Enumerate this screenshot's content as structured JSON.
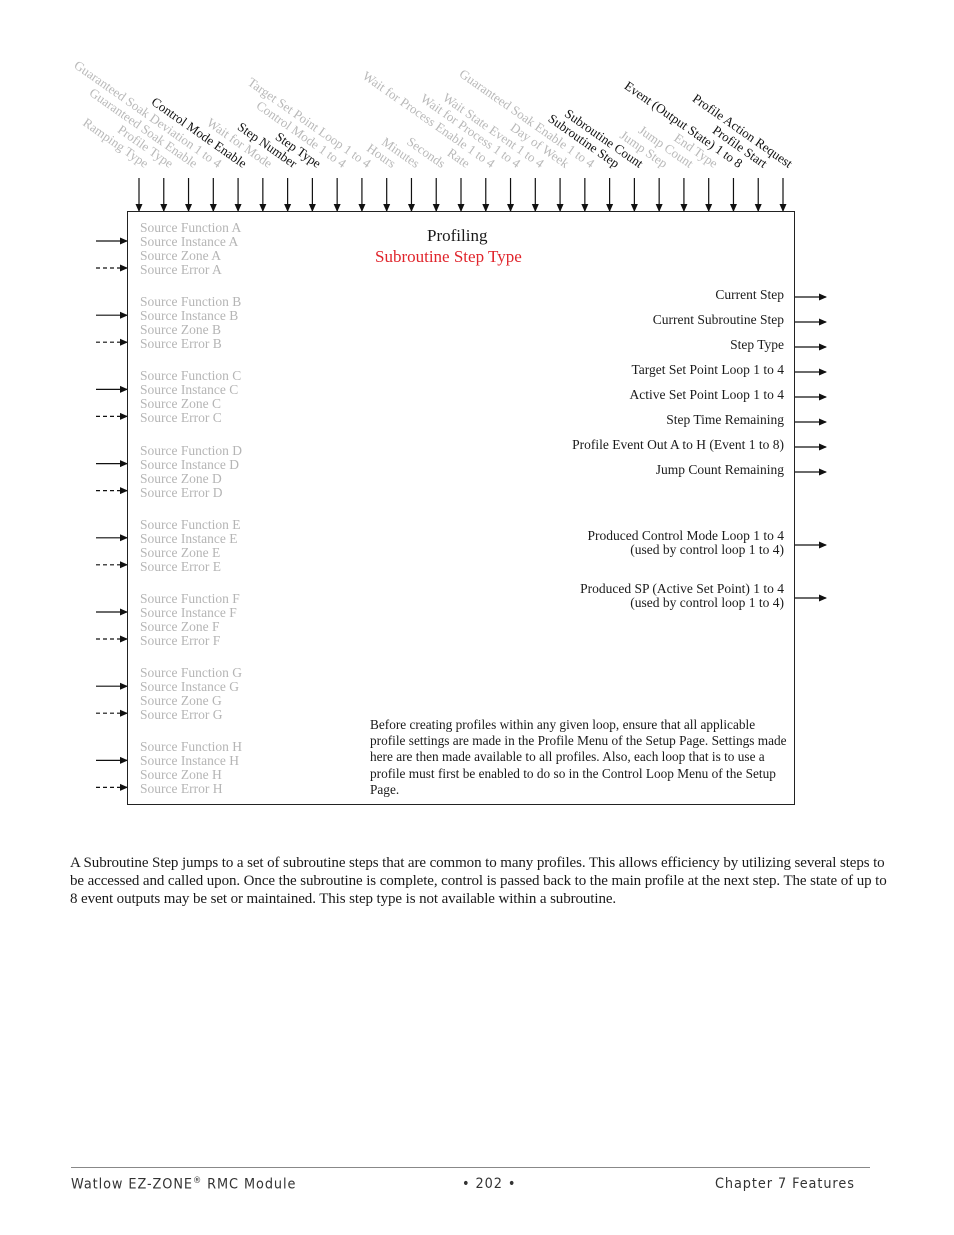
{
  "diagram": {
    "title": "Profiling",
    "subtitle": "Subroutine Step Type",
    "subtitle_color": "#e0242b",
    "top_inputs": [
      {
        "label": "Ramping Type",
        "active": false
      },
      {
        "label": "Profile Type",
        "active": false
      },
      {
        "label": "Guaranteed Soak Enable",
        "active": false
      },
      {
        "label": "Guaranteed Soak Deviation 1 to 4",
        "active": false
      },
      {
        "label": "Control Mode Enable",
        "active": true
      },
      {
        "label": "Wait for Mode",
        "active": false
      },
      {
        "label": "Step Number",
        "active": true
      },
      {
        "label": "Step Type",
        "active": true
      },
      {
        "label": "Control Mode 1 to 4",
        "active": false
      },
      {
        "label": "Target Set Point Loop 1 to 4",
        "active": false
      },
      {
        "label": "Hours",
        "active": false
      },
      {
        "label": "Minutes",
        "active": false
      },
      {
        "label": "Seconds",
        "active": false
      },
      {
        "label": "Rate",
        "active": false
      },
      {
        "label": "Wait for Process Enable 1 to 4",
        "active": false
      },
      {
        "label": "Wait for Process 1 to 4",
        "active": false
      },
      {
        "label": "Wait State Event 1 to 4",
        "active": false
      },
      {
        "label": "Day of Week",
        "active": false
      },
      {
        "label": "Guaranteed Soak Enable 1 to 4",
        "active": false
      },
      {
        "label": "Subroutine Step",
        "active": true
      },
      {
        "label": "Subroutine Count",
        "active": true
      },
      {
        "label": "Jump Step",
        "active": false
      },
      {
        "label": "Jump Count",
        "active": false
      },
      {
        "label": "End Type",
        "active": false
      },
      {
        "label": "Event (Output State) 1 to 8",
        "active": true
      },
      {
        "label": "Profile Start",
        "active": true
      },
      {
        "label": "Profile Action Request",
        "active": true
      }
    ],
    "source_groups": [
      [
        "Source Function A",
        "Source Instance A",
        "Source Zone A",
        "Source Error A"
      ],
      [
        "Source Function B",
        "Source Instance B",
        "Source Zone B",
        "Source Error B"
      ],
      [
        "Source Function C",
        "Source Instance C",
        "Source Zone C",
        "Source Error C"
      ],
      [
        "Source Function D",
        "Source Instance D",
        "Source Zone D",
        "Source Error D"
      ],
      [
        "Source Function E",
        "Source Instance E",
        "Source Zone E",
        "Source Error E"
      ],
      [
        "Source Function F",
        "Source Instance F",
        "Source Zone F",
        "Source Error F"
      ],
      [
        "Source Function G",
        "Source Instance G",
        "Source Zone G",
        "Source Error G"
      ],
      [
        "Source Function H",
        "Source Instance H",
        "Source Zone H",
        "Source Error H"
      ]
    ],
    "outputs": [
      [
        "Current Step"
      ],
      [
        "Current Subroutine Step"
      ],
      [
        "Step Type"
      ],
      [
        "Target Set Point Loop 1 to 4"
      ],
      [
        "Active Set Point Loop 1 to 4"
      ],
      [
        "Step Time Remaining"
      ],
      [
        "Profile Event Out A to H (Event 1 to 8)"
      ],
      [
        "Jump Count Remaining"
      ],
      [
        "Produced Control Mode Loop 1 to 4",
        "(used by control loop 1 to 4)"
      ],
      [
        "Produced SP (Active Set Point) 1 to 4",
        "(used by control loop 1 to 4)"
      ]
    ],
    "note": "Before creating profiles within any given loop, ensure that all applicable profile settings are made in the Profile Menu of the Setup Page. Settings made here are then made available to all profiles. Also, each loop that is to use a profile must first be enabled to do so in the Control Loop Menu of the Setup Page."
  },
  "body_text": "A Subroutine Step jumps to a set of subroutine steps that are common to many profiles. This allows efficiency by utilizing several steps to be accessed and called upon. Once the subroutine is complete, control is passed back to the main profile at the next step. The state of up to 8 event outputs may be set or maintained. This step type is not available within a subroutine.",
  "footer": {
    "left": "Watlow EZ-ZONE",
    "left_mark": "®",
    "left_suffix": " RMC Module",
    "center": "•  202  •",
    "right": "Chapter 7 Features"
  }
}
